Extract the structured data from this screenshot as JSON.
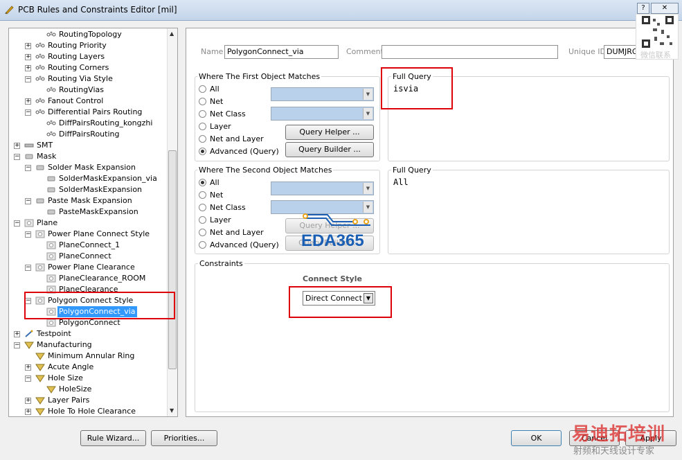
{
  "window": {
    "title": "PCB Rules and Constraints Editor [mil]"
  },
  "tree": [
    {
      "label": "RoutingTopology",
      "level": 2,
      "icon": "rule-icon",
      "expander": ""
    },
    {
      "label": "Routing Priority",
      "level": 1,
      "icon": "category-icon",
      "expander": "+"
    },
    {
      "label": "Routing Layers",
      "level": 1,
      "icon": "category-icon",
      "expander": "+"
    },
    {
      "label": "Routing Corners",
      "level": 1,
      "icon": "category-icon",
      "expander": "+"
    },
    {
      "label": "Routing Via Style",
      "level": 1,
      "icon": "category-icon",
      "expander": "-"
    },
    {
      "label": "RoutingVias",
      "level": 2,
      "icon": "rule-icon",
      "expander": ""
    },
    {
      "label": "Fanout Control",
      "level": 1,
      "icon": "category-icon",
      "expander": "+"
    },
    {
      "label": "Differential Pairs Routing",
      "level": 1,
      "icon": "category-icon",
      "expander": "-"
    },
    {
      "label": "DiffPairsRouting_kongzhi",
      "level": 2,
      "icon": "rule-icon",
      "expander": ""
    },
    {
      "label": "DiffPairsRouting",
      "level": 2,
      "icon": "rule-icon",
      "expander": ""
    },
    {
      "label": "SMT",
      "level": 0,
      "icon": "smt-icon",
      "expander": "+"
    },
    {
      "label": "Mask",
      "level": 0,
      "icon": "mask-icon",
      "expander": "-"
    },
    {
      "label": "Solder Mask Expansion",
      "level": 1,
      "icon": "mask-icon",
      "expander": "-"
    },
    {
      "label": "SolderMaskExpansion_via",
      "level": 2,
      "icon": "mask-icon",
      "expander": ""
    },
    {
      "label": "SolderMaskExpansion",
      "level": 2,
      "icon": "mask-icon",
      "expander": ""
    },
    {
      "label": "Paste Mask Expansion",
      "level": 1,
      "icon": "mask-icon",
      "expander": "-"
    },
    {
      "label": "PasteMaskExpansion",
      "level": 2,
      "icon": "mask-icon",
      "expander": ""
    },
    {
      "label": "Plane",
      "level": 0,
      "icon": "plane-icon",
      "expander": "-"
    },
    {
      "label": "Power Plane Connect Style",
      "level": 1,
      "icon": "plane-icon",
      "expander": "-"
    },
    {
      "label": "PlaneConnect_1",
      "level": 2,
      "icon": "plane-icon",
      "expander": ""
    },
    {
      "label": "PlaneConnect",
      "level": 2,
      "icon": "plane-icon",
      "expander": ""
    },
    {
      "label": "Power Plane Clearance",
      "level": 1,
      "icon": "plane-icon",
      "expander": "-"
    },
    {
      "label": "PlaneClearance_ROOM",
      "level": 2,
      "icon": "plane-icon",
      "expander": ""
    },
    {
      "label": "PlaneClearance",
      "level": 2,
      "icon": "plane-icon",
      "expander": ""
    },
    {
      "label": "Polygon Connect Style",
      "level": 1,
      "icon": "plane-icon",
      "expander": "-"
    },
    {
      "label": "PolygonConnect_via",
      "level": 2,
      "icon": "plane-icon",
      "expander": "",
      "selected": true
    },
    {
      "label": "PolygonConnect",
      "level": 2,
      "icon": "plane-icon",
      "expander": ""
    },
    {
      "label": "Testpoint",
      "level": 0,
      "icon": "testpoint-icon",
      "expander": "+"
    },
    {
      "label": "Manufacturing",
      "level": 0,
      "icon": "manufacturing-icon",
      "expander": "-"
    },
    {
      "label": "Minimum Annular Ring",
      "level": 1,
      "icon": "manufacturing-icon",
      "expander": ""
    },
    {
      "label": "Acute Angle",
      "level": 1,
      "icon": "manufacturing-icon",
      "expander": "+"
    },
    {
      "label": "Hole Size",
      "level": 1,
      "icon": "manufacturing-icon",
      "expander": "-"
    },
    {
      "label": "HoleSize",
      "level": 2,
      "icon": "manufacturing-icon",
      "expander": ""
    },
    {
      "label": "Layer Pairs",
      "level": 1,
      "icon": "manufacturing-icon",
      "expander": "+"
    },
    {
      "label": "Hole To Hole Clearance",
      "level": 1,
      "icon": "manufacturing-icon",
      "expander": "+"
    }
  ],
  "header": {
    "name_label": "Name",
    "name_value": "PolygonConnect_via",
    "comment_label": "Comment",
    "comment_value": "",
    "uid_label": "Unique ID",
    "uid_value": "DUMJRGIL"
  },
  "first_match": {
    "title": "Where The First Object Matches",
    "options": [
      "All",
      "Net",
      "Net Class",
      "Layer",
      "Net and Layer",
      "Advanced (Query)"
    ],
    "selected": "Advanced (Query)",
    "query_helper": "Query Helper ...",
    "query_builder": "Query Builder ...",
    "full_query_title": "Full Query",
    "full_query": "isvia"
  },
  "second_match": {
    "title": "Where The Second Object Matches",
    "options": [
      "All",
      "Net",
      "Net Class",
      "Layer",
      "Net and Layer",
      "Advanced (Query)"
    ],
    "selected": "All",
    "query_helper": "Query Helper ...",
    "query_builder": "Query Builder ...",
    "full_query_title": "Full Query",
    "full_query": "All"
  },
  "constraints": {
    "title": "Constraints",
    "connect_style_label": "Connect Style",
    "connect_style_value": "Direct Connect"
  },
  "buttons": {
    "rule_wizard": "Rule Wizard...",
    "priorities": "Priorities...",
    "ok": "OK",
    "cancel": "Cancel",
    "apply": "Apply"
  },
  "watermarks": {
    "eda": "EDA365",
    "brand": "易迪拓培训",
    "brand_sub": "射频和天线设计专家",
    "qr_text": "微信联系"
  }
}
